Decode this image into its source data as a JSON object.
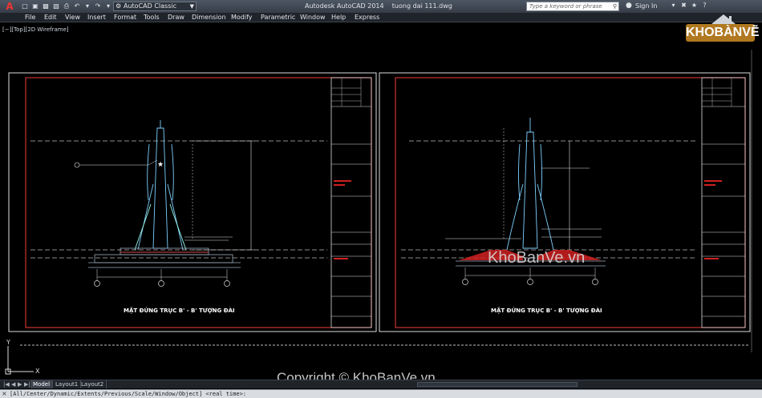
{
  "titlebar": {
    "workspace": "AutoCAD Classic",
    "app_name": "Autodesk AutoCAD 2014",
    "file_name": "tuong dai 111.dwg",
    "search_placeholder": "Type a keyword or phrase",
    "sign_in": "Sign In"
  },
  "menu": [
    "File",
    "Edit",
    "View",
    "Insert",
    "Format",
    "Tools",
    "Draw",
    "Dimension",
    "Modify",
    "Parametric",
    "Window",
    "Help",
    "Express"
  ],
  "viewport_label": "[−][Top][2D Wireframe]",
  "sheets": [
    {
      "title": "MẶT ĐỨNG TRỤC B' - B' TƯỢNG ĐÀI"
    },
    {
      "title": "MẶT ĐỨNG TRỤC B' - B' TƯỢNG ĐÀI"
    }
  ],
  "layout_tabs": [
    "Model",
    "Layout1",
    "Layout2"
  ],
  "active_tab": "Model",
  "command_line": "[All/Center/Dynamic/Extents/Previous/Scale/Window/Object] <real time>:",
  "watermark": {
    "logo_text": "KHOBÀNVẼ",
    "mid_text": "KhoBanVe.vn",
    "copyright_text": "Copyright © KhoBanVe.vn"
  },
  "colors": {
    "sheet_border": "#c83232",
    "frame": "#dddddd",
    "lines": "#7fd0ff",
    "ground_red": "#d02020",
    "logo_bg": "#b07820"
  }
}
